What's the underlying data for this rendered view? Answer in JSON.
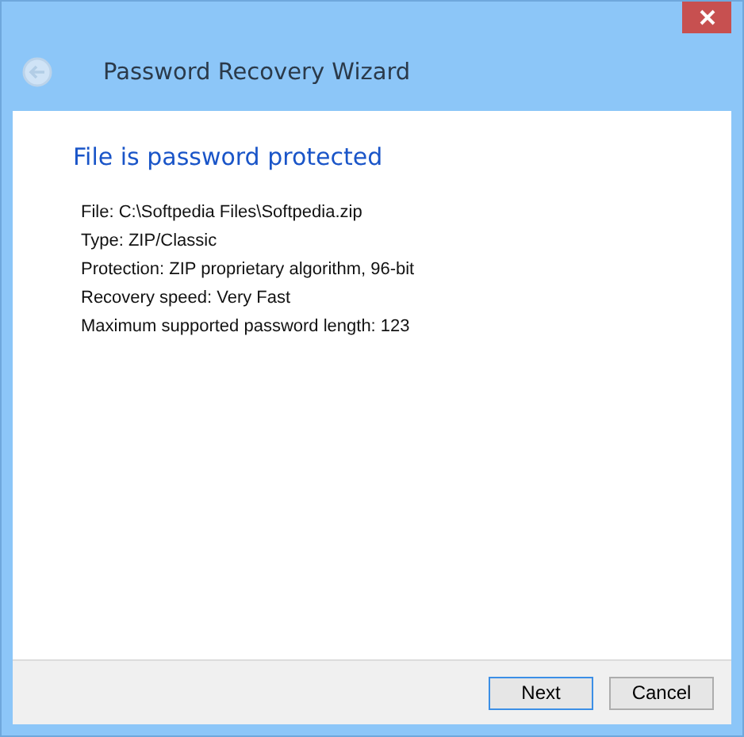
{
  "window": {
    "title": "Password Recovery Wizard"
  },
  "back_button": {
    "disabled": true
  },
  "heading": "File is password protected",
  "details": [
    "File: C:\\Softpedia Files\\Softpedia.zip",
    "Type: ZIP/Classic",
    "Protection: ZIP proprietary algorithm, 96-bit",
    "Recovery speed: Very Fast",
    "Maximum supported password length: 123"
  ],
  "buttons": [
    {
      "label": "Next",
      "default": true
    },
    {
      "label": "Cancel",
      "default": false
    }
  ]
}
